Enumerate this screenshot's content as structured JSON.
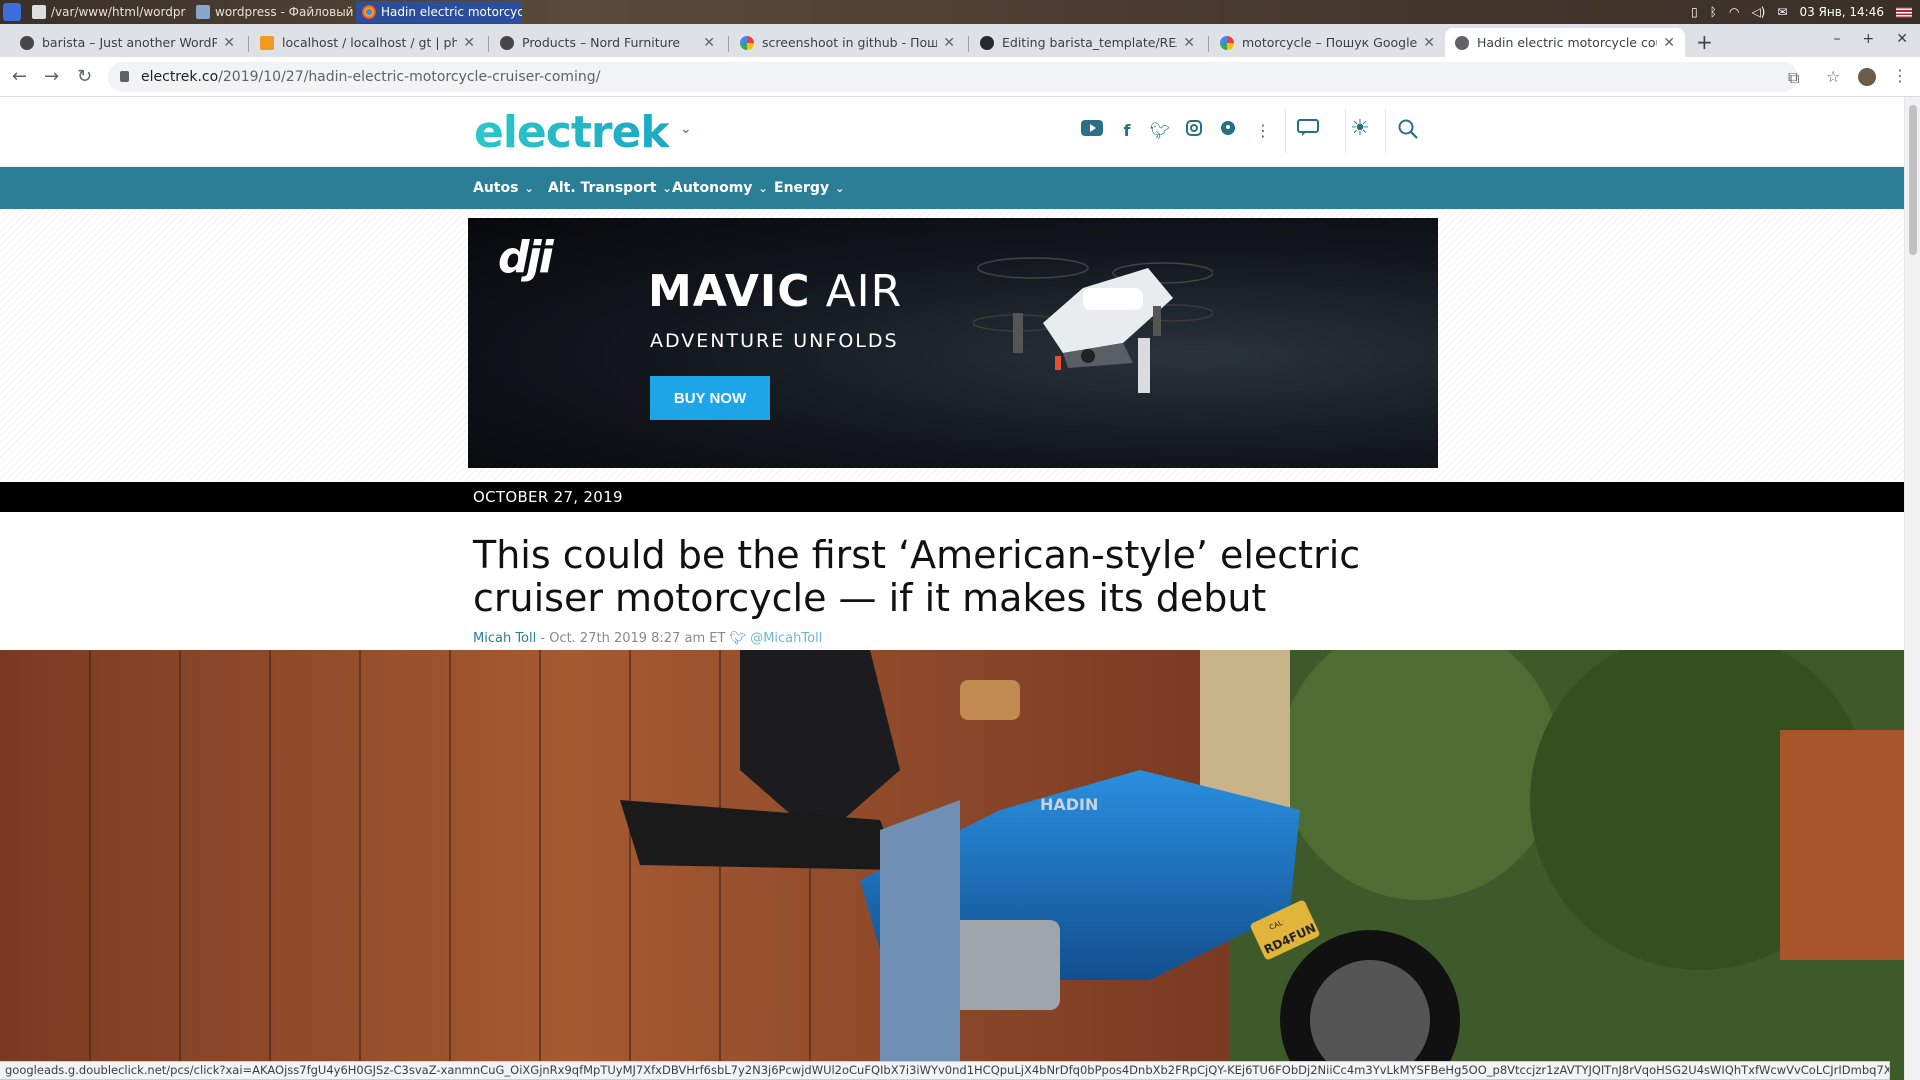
{
  "taskbar": {
    "tasks": [
      {
        "label": "/var/www/html/wordpress/w..."
      },
      {
        "label": "wordpress - Файловый мен..."
      },
      {
        "label": "Hadin electric motorcycle co..."
      }
    ],
    "date_time": "03 Янв, 14:46"
  },
  "browser": {
    "tabs": [
      {
        "title": "barista – Just another WordPre"
      },
      {
        "title": "localhost / localhost / gt | phpM"
      },
      {
        "title": "Products – Nord Furniture"
      },
      {
        "title": "screenshoot in github - Пошук"
      },
      {
        "title": "Editing barista_template/READ"
      },
      {
        "title": "motorcycle – Пошук Google"
      },
      {
        "title": "Hadin electric motorcycle could"
      }
    ],
    "new_tab": "+",
    "url_host": "electrek.co",
    "url_path": "/2019/10/27/hadin-electric-motorcycle-cruiser-coming/",
    "status_url": "googleads.g.doubleclick.net/pcs/click?xai=AKAOjss7fgU4y6H0GJSz-C3svaZ-xanmnCuG_OiXGjnRx9qfMpTUyMJ7XfxDBVHrf6sbL7y2N3j6PcwjdWUl2oCuFQIbX7i3iWYv0nd1HCQpuLjX4bNrDfq0bPpos4DnbXb2FRpCjQY-KEj6TU6FObDj2NiiCc4m3YvLkMYSFBeHg5OO_p8Vtccjzr1zAVTYJQlTnJ8rVqoHSG2U4sWIQhTxfWcwVvCoLCJrIDmbq7XCIGfWlf..."
  },
  "site": {
    "logo": "electrek",
    "nav": [
      {
        "label": "Autos"
      },
      {
        "label": "Alt. Transport"
      },
      {
        "label": "Autonomy"
      },
      {
        "label": "Energy"
      }
    ],
    "ad": {
      "brand": "dji",
      "product_bold": "MAVIC",
      "product_light": " AIR",
      "tagline": "ADVENTURE UNFOLDS",
      "cta": "BUY NOW"
    }
  },
  "article": {
    "date": "OCTOBER 27, 2019",
    "title": "This could be the first ‘American-style’ electric cruiser motorcycle — if it makes its debut",
    "author": "Micah Toll",
    "published": " - Oct. 27th 2019 8:27 am ET ",
    "twitter_handle": "@MicahToll",
    "hero": {
      "bike_brand": "HADIN",
      "plate": "RD4FUN",
      "plate_state": "CAL"
    }
  },
  "colors": {
    "brand_teal": "#2a7f96",
    "logo_teal": "#2cc7c8",
    "cta_blue": "#1ea5e8",
    "bike_blue": "#1e6fb8"
  }
}
